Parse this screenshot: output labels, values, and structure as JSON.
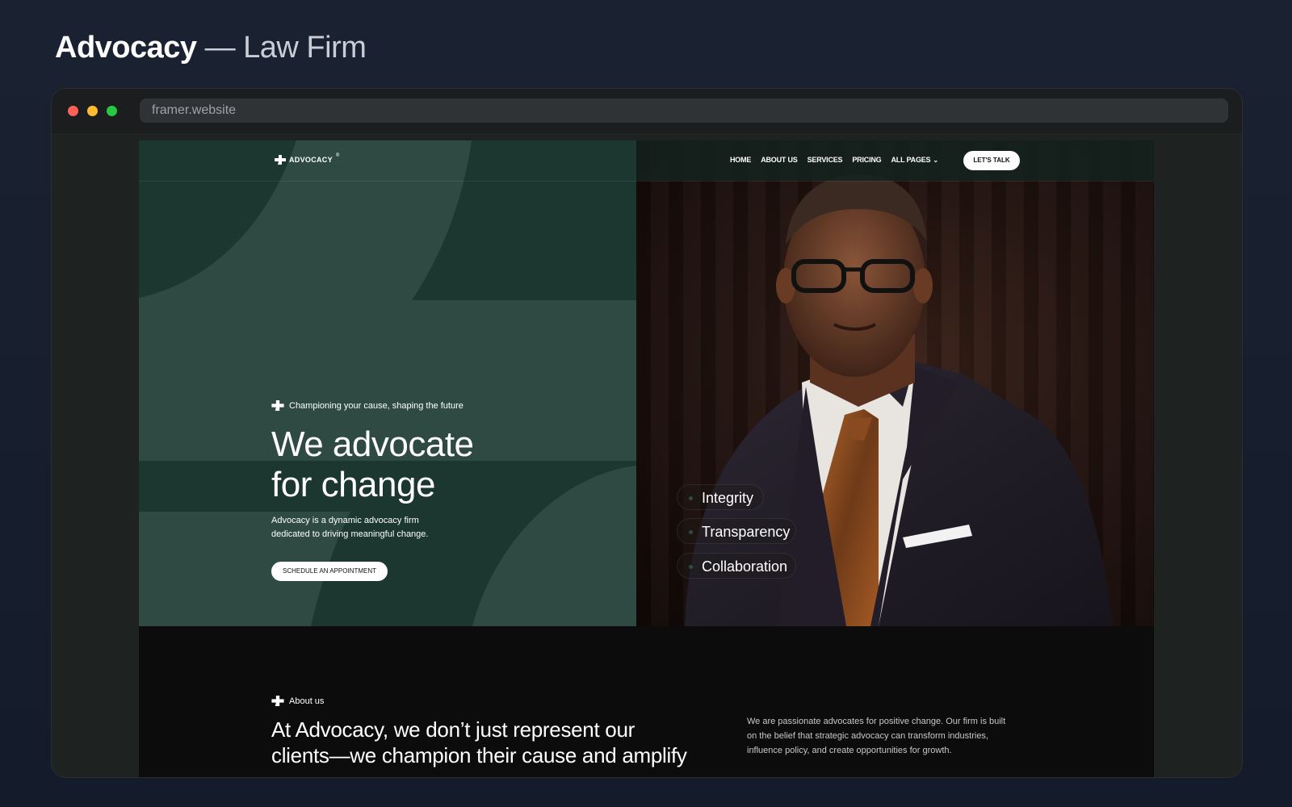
{
  "page": {
    "title_bold": "Advocacy",
    "title_rest": " — Law Firm"
  },
  "browser": {
    "url": "framer.website"
  },
  "site": {
    "logo": {
      "text": "ADVOCACY",
      "mark": "®"
    },
    "nav": {
      "items": [
        "HOME",
        "ABOUT US",
        "SERVICES",
        "PRICING",
        "ALL PAGES"
      ],
      "cta": "LET'S TALK"
    },
    "hero": {
      "tagline": "Championing your cause, shaping the future",
      "title_lines": [
        "We advocate",
        "for change"
      ],
      "description_lines": [
        "Advocacy is a dynamic advocacy firm",
        "dedicated to driving meaningful change."
      ],
      "cta": "SCHEDULE AN APPOINTMENT",
      "values": [
        "Integrity",
        "Transparency",
        "Collaboration"
      ]
    },
    "about": {
      "label": "About us",
      "title_lines": [
        "At Advocacy, we don’t just represent our",
        "clients—we champion their cause and amplify"
      ],
      "description_lines": [
        "We are passionate advocates for positive change. Our firm is built",
        "on the belief that strategic advocacy can transform industries,",
        "influence policy, and create opportunities for growth."
      ]
    }
  },
  "colors": {
    "hero_green": "#2f4a43",
    "hero_green_dark": "#1c3630",
    "background": "#0c0c0c"
  }
}
